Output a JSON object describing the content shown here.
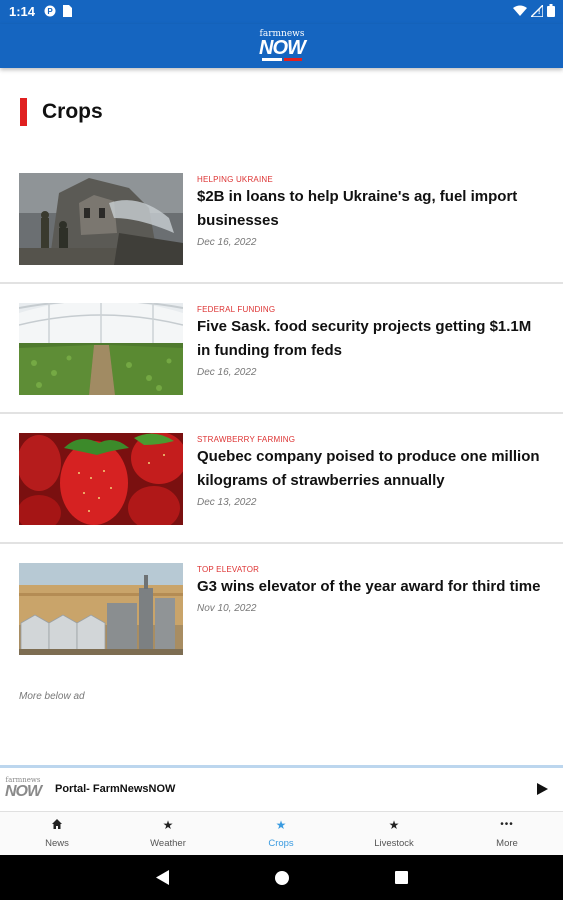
{
  "status_bar": {
    "time": "1:14",
    "icons": [
      "notification-icon",
      "sim-icon",
      "wifi-icon",
      "signal-icon",
      "battery-icon"
    ]
  },
  "app_bar": {
    "logo_top": "farmnews",
    "logo_main": "NOW"
  },
  "section": {
    "title": "Crops",
    "accent_color": "#e02020"
  },
  "articles": [
    {
      "category": "HELPING UKRAINE",
      "title": "$2B in loans to help Ukraine's ag, fuel import businesses",
      "date": "Dec 16, 2022"
    },
    {
      "category": "FEDERAL FUNDING",
      "title": "Five Sask. food security projects getting $1.1M in funding from feds",
      "date": "Dec 16, 2022"
    },
    {
      "category": "STRAWBERRY FARMING",
      "title": "Quebec company poised to produce one million kilograms of strawberries annually",
      "date": "Dec 13, 2022"
    },
    {
      "category": "TOP ELEVATOR",
      "title": "G3 wins elevator of the year award for third time",
      "date": "Nov 10, 2022"
    }
  ],
  "more_below": "More below ad",
  "player": {
    "logo_top": "farmnews",
    "logo_main": "NOW",
    "title": "Portal- FarmNewsNOW"
  },
  "bottom_nav": {
    "items": [
      {
        "label": "News",
        "icon": "home-icon"
      },
      {
        "label": "Weather",
        "icon": "star-icon"
      },
      {
        "label": "Crops",
        "icon": "star-icon",
        "active": true
      },
      {
        "label": "Livestock",
        "icon": "star-icon"
      },
      {
        "label": "More",
        "icon": "more-icon"
      }
    ],
    "active_color": "#3a9be0"
  },
  "colors": {
    "brand_blue": "#1565c0",
    "category_red": "#dd3333"
  }
}
